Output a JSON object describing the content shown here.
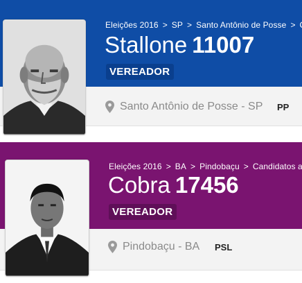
{
  "candidates": [
    {
      "breadcrumb": [
        "Eleições 2016",
        "SP",
        "Santo Antônio de Posse",
        "C"
      ],
      "name": "Stallone",
      "number": "11007",
      "role": "VEREADOR",
      "location": "Santo Antônio de Posse - SP",
      "party": "PP",
      "colors": {
        "banner": "#0f4da6",
        "badge": "#0a3f8e"
      },
      "photo_icon": "candidate-photo"
    },
    {
      "breadcrumb": [
        "Eleições 2016",
        "BA",
        "Pindobaçu",
        "Candidatos a"
      ],
      "name": "Cobra",
      "number": "17456",
      "role": "VEREADOR",
      "location": "Pindobaçu - BA",
      "party": "PSL",
      "colors": {
        "banner": "#7a1470",
        "badge": "#5f0f58"
      },
      "photo_icon": "candidate-photo"
    }
  ],
  "separator": ">",
  "location_icon": "map-pin-icon"
}
